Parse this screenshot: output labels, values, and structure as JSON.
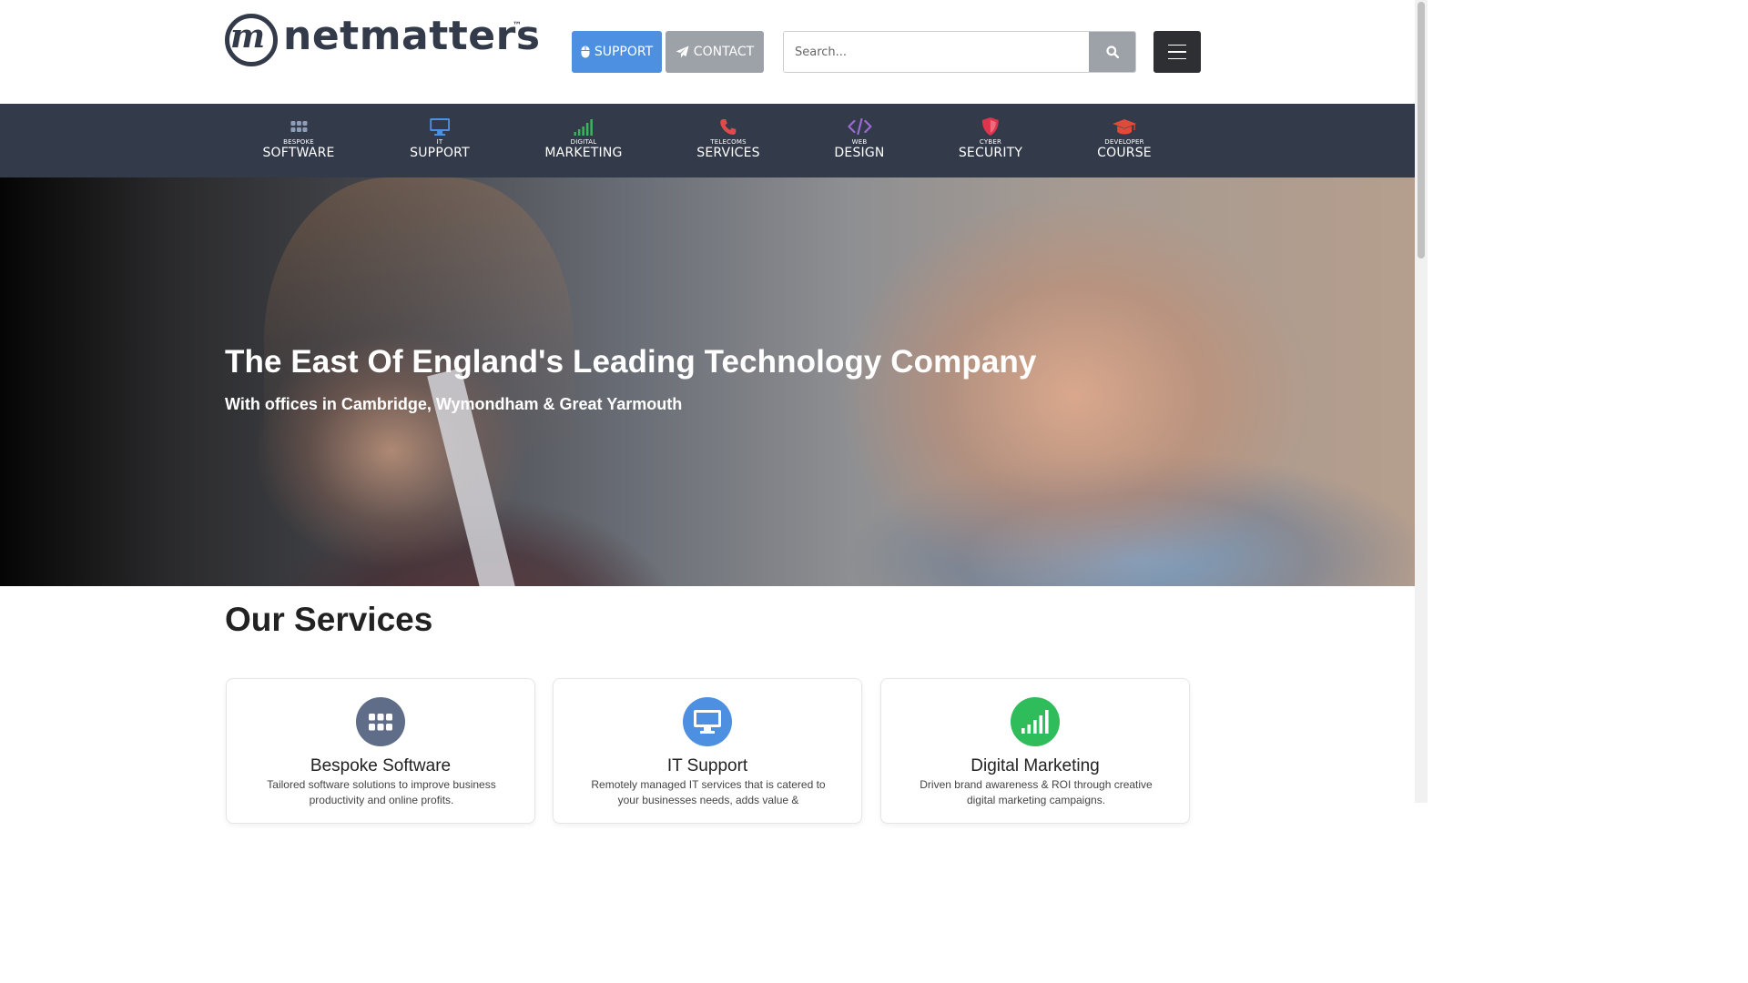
{
  "header": {
    "logo_text": "netmatters",
    "logo_mark": "m",
    "logo_tm": "™",
    "support_label": "SUPPORT",
    "contact_label": "CONTACT",
    "search_placeholder": "Search...",
    "menu_icon": "hamburger-icon"
  },
  "nav": {
    "items": [
      {
        "small": "BESPOKE",
        "big": "SOFTWARE",
        "icon": "grid-icon",
        "color": "#8f9db8"
      },
      {
        "small": "IT",
        "big": "SUPPORT",
        "icon": "monitor-icon",
        "color": "#4d90e1"
      },
      {
        "small": "DIGITAL",
        "big": "MARKETING",
        "icon": "signal-bars-icon",
        "color": "#3ab55a"
      },
      {
        "small": "TELECOMS",
        "big": "SERVICES",
        "icon": "phone-icon",
        "color": "#e04a4a"
      },
      {
        "small": "WEB",
        "big": "DESIGN",
        "icon": "code-icon",
        "color": "#9b6bd1"
      },
      {
        "small": "CYBER",
        "big": "SECURITY",
        "icon": "shield-icon",
        "color": "#e0334d"
      },
      {
        "small": "DEVELOPER",
        "big": "COURSE",
        "icon": "graduation-cap-icon",
        "color": "#e04a3a"
      }
    ]
  },
  "hero": {
    "title": "The East Of England's Leading Technology Company",
    "subtitle": "With offices in Cambridge, Wymondham & Great Yarmouth"
  },
  "services": {
    "title": "Our Services",
    "cards": [
      {
        "title": "Bespoke Software",
        "desc": "Tailored software solutions to improve business productivity and online profits.",
        "icon": "grid-icon",
        "color": "#5f6d88"
      },
      {
        "title": "IT Support",
        "desc": "Remotely managed IT services that is catered to your businesses needs, adds value &",
        "icon": "monitor-icon",
        "color": "#4d90e1"
      },
      {
        "title": "Digital Marketing",
        "desc": "Driven brand awareness & ROI through creative digital marketing campaigns.",
        "icon": "signal-bars-icon",
        "color": "#2ebd5a"
      }
    ]
  },
  "colors": {
    "nav_bg": "#333a4a",
    "support_btn": "#4d90e1",
    "contact_btn": "#9da2a8",
    "menu_btn": "#2d2f33"
  }
}
